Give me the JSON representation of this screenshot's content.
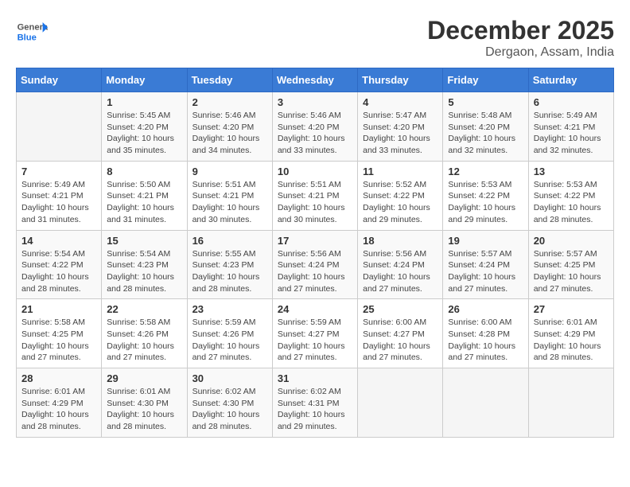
{
  "header": {
    "logo_line1": "General",
    "logo_line2": "Blue",
    "month": "December 2025",
    "location": "Dergaon, Assam, India"
  },
  "days_of_week": [
    "Sunday",
    "Monday",
    "Tuesday",
    "Wednesday",
    "Thursday",
    "Friday",
    "Saturday"
  ],
  "weeks": [
    [
      {
        "day": null
      },
      {
        "day": 1,
        "sunrise": "5:45 AM",
        "sunset": "4:20 PM",
        "daylight": "10 hours and 35 minutes."
      },
      {
        "day": 2,
        "sunrise": "5:46 AM",
        "sunset": "4:20 PM",
        "daylight": "10 hours and 34 minutes."
      },
      {
        "day": 3,
        "sunrise": "5:46 AM",
        "sunset": "4:20 PM",
        "daylight": "10 hours and 33 minutes."
      },
      {
        "day": 4,
        "sunrise": "5:47 AM",
        "sunset": "4:20 PM",
        "daylight": "10 hours and 33 minutes."
      },
      {
        "day": 5,
        "sunrise": "5:48 AM",
        "sunset": "4:20 PM",
        "daylight": "10 hours and 32 minutes."
      },
      {
        "day": 6,
        "sunrise": "5:49 AM",
        "sunset": "4:21 PM",
        "daylight": "10 hours and 32 minutes."
      }
    ],
    [
      {
        "day": 7,
        "sunrise": "5:49 AM",
        "sunset": "4:21 PM",
        "daylight": "10 hours and 31 minutes."
      },
      {
        "day": 8,
        "sunrise": "5:50 AM",
        "sunset": "4:21 PM",
        "daylight": "10 hours and 31 minutes."
      },
      {
        "day": 9,
        "sunrise": "5:51 AM",
        "sunset": "4:21 PM",
        "daylight": "10 hours and 30 minutes."
      },
      {
        "day": 10,
        "sunrise": "5:51 AM",
        "sunset": "4:21 PM",
        "daylight": "10 hours and 30 minutes."
      },
      {
        "day": 11,
        "sunrise": "5:52 AM",
        "sunset": "4:22 PM",
        "daylight": "10 hours and 29 minutes."
      },
      {
        "day": 12,
        "sunrise": "5:53 AM",
        "sunset": "4:22 PM",
        "daylight": "10 hours and 29 minutes."
      },
      {
        "day": 13,
        "sunrise": "5:53 AM",
        "sunset": "4:22 PM",
        "daylight": "10 hours and 28 minutes."
      }
    ],
    [
      {
        "day": 14,
        "sunrise": "5:54 AM",
        "sunset": "4:22 PM",
        "daylight": "10 hours and 28 minutes."
      },
      {
        "day": 15,
        "sunrise": "5:54 AM",
        "sunset": "4:23 PM",
        "daylight": "10 hours and 28 minutes."
      },
      {
        "day": 16,
        "sunrise": "5:55 AM",
        "sunset": "4:23 PM",
        "daylight": "10 hours and 28 minutes."
      },
      {
        "day": 17,
        "sunrise": "5:56 AM",
        "sunset": "4:24 PM",
        "daylight": "10 hours and 27 minutes."
      },
      {
        "day": 18,
        "sunrise": "5:56 AM",
        "sunset": "4:24 PM",
        "daylight": "10 hours and 27 minutes."
      },
      {
        "day": 19,
        "sunrise": "5:57 AM",
        "sunset": "4:24 PM",
        "daylight": "10 hours and 27 minutes."
      },
      {
        "day": 20,
        "sunrise": "5:57 AM",
        "sunset": "4:25 PM",
        "daylight": "10 hours and 27 minutes."
      }
    ],
    [
      {
        "day": 21,
        "sunrise": "5:58 AM",
        "sunset": "4:25 PM",
        "daylight": "10 hours and 27 minutes."
      },
      {
        "day": 22,
        "sunrise": "5:58 AM",
        "sunset": "4:26 PM",
        "daylight": "10 hours and 27 minutes."
      },
      {
        "day": 23,
        "sunrise": "5:59 AM",
        "sunset": "4:26 PM",
        "daylight": "10 hours and 27 minutes."
      },
      {
        "day": 24,
        "sunrise": "5:59 AM",
        "sunset": "4:27 PM",
        "daylight": "10 hours and 27 minutes."
      },
      {
        "day": 25,
        "sunrise": "6:00 AM",
        "sunset": "4:27 PM",
        "daylight": "10 hours and 27 minutes."
      },
      {
        "day": 26,
        "sunrise": "6:00 AM",
        "sunset": "4:28 PM",
        "daylight": "10 hours and 27 minutes."
      },
      {
        "day": 27,
        "sunrise": "6:01 AM",
        "sunset": "4:29 PM",
        "daylight": "10 hours and 28 minutes."
      }
    ],
    [
      {
        "day": 28,
        "sunrise": "6:01 AM",
        "sunset": "4:29 PM",
        "daylight": "10 hours and 28 minutes."
      },
      {
        "day": 29,
        "sunrise": "6:01 AM",
        "sunset": "4:30 PM",
        "daylight": "10 hours and 28 minutes."
      },
      {
        "day": 30,
        "sunrise": "6:02 AM",
        "sunset": "4:30 PM",
        "daylight": "10 hours and 28 minutes."
      },
      {
        "day": 31,
        "sunrise": "6:02 AM",
        "sunset": "4:31 PM",
        "daylight": "10 hours and 29 minutes."
      },
      {
        "day": null
      },
      {
        "day": null
      },
      {
        "day": null
      }
    ]
  ]
}
